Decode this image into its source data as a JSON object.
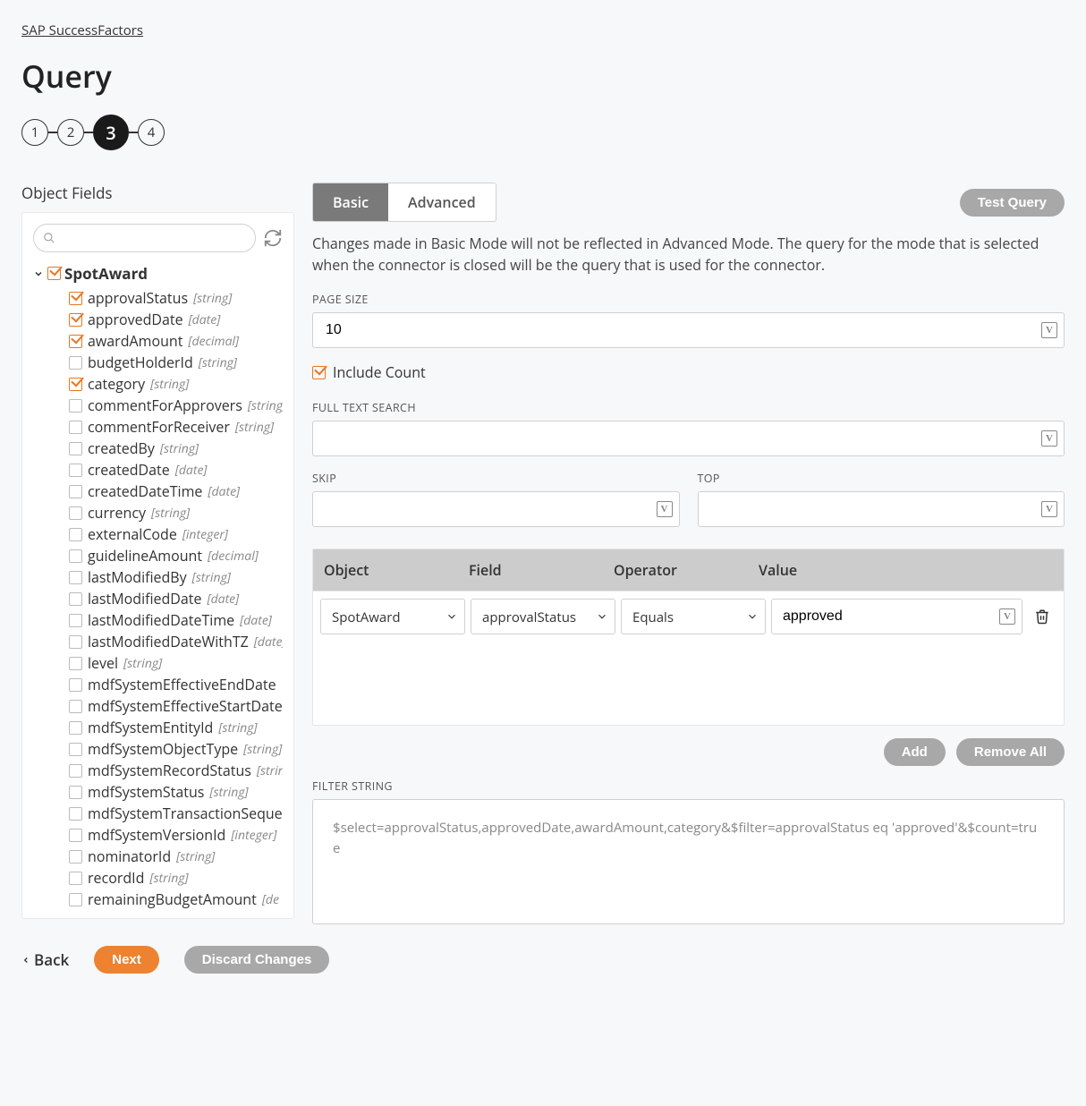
{
  "breadcrumb": "SAP SuccessFactors",
  "page_title": "Query",
  "stepper": {
    "steps": [
      "1",
      "2",
      "3",
      "4"
    ],
    "active_index": 2
  },
  "left": {
    "title": "Object Fields",
    "search_placeholder": "",
    "root_name": "SpotAward",
    "fields": [
      {
        "name": "approvalStatus",
        "type": "[string]",
        "checked": true
      },
      {
        "name": "approvedDate",
        "type": "[date]",
        "checked": true
      },
      {
        "name": "awardAmount",
        "type": "[decimal]",
        "checked": true
      },
      {
        "name": "budgetHolderId",
        "type": "[string]",
        "checked": false
      },
      {
        "name": "category",
        "type": "[string]",
        "checked": true
      },
      {
        "name": "commentForApprovers",
        "type": "[string]",
        "checked": false
      },
      {
        "name": "commentForReceiver",
        "type": "[string]",
        "checked": false
      },
      {
        "name": "createdBy",
        "type": "[string]",
        "checked": false
      },
      {
        "name": "createdDate",
        "type": "[date]",
        "checked": false
      },
      {
        "name": "createdDateTime",
        "type": "[date]",
        "checked": false
      },
      {
        "name": "currency",
        "type": "[string]",
        "checked": false
      },
      {
        "name": "externalCode",
        "type": "[integer]",
        "checked": false
      },
      {
        "name": "guidelineAmount",
        "type": "[decimal]",
        "checked": false
      },
      {
        "name": "lastModifiedBy",
        "type": "[string]",
        "checked": false
      },
      {
        "name": "lastModifiedDate",
        "type": "[date]",
        "checked": false
      },
      {
        "name": "lastModifiedDateTime",
        "type": "[date]",
        "checked": false
      },
      {
        "name": "lastModifiedDateWithTZ",
        "type": "[date]",
        "checked": false
      },
      {
        "name": "level",
        "type": "[string]",
        "checked": false
      },
      {
        "name": "mdfSystemEffectiveEndDate",
        "type": "",
        "checked": false
      },
      {
        "name": "mdfSystemEffectiveStartDate",
        "type": "",
        "checked": false
      },
      {
        "name": "mdfSystemEntityId",
        "type": "[string]",
        "checked": false
      },
      {
        "name": "mdfSystemObjectType",
        "type": "[string]",
        "checked": false
      },
      {
        "name": "mdfSystemRecordStatus",
        "type": "[string]",
        "checked": false
      },
      {
        "name": "mdfSystemStatus",
        "type": "[string]",
        "checked": false
      },
      {
        "name": "mdfSystemTransactionSequence",
        "type": "",
        "checked": false
      },
      {
        "name": "mdfSystemVersionId",
        "type": "[integer]",
        "checked": false
      },
      {
        "name": "nominatorId",
        "type": "[string]",
        "checked": false
      },
      {
        "name": "recordId",
        "type": "[string]",
        "checked": false
      },
      {
        "name": "remainingBudgetAmount",
        "type": "[de",
        "checked": false
      }
    ]
  },
  "right": {
    "tabs": {
      "basic": "Basic",
      "advanced": "Advanced",
      "active": "basic"
    },
    "test_query": "Test Query",
    "note": "Changes made in Basic Mode will not be reflected in Advanced Mode. The query for the mode that is selected when the connector is closed will be the query that is used for the connector.",
    "page_size_label": "PAGE SIZE",
    "page_size_value": "10",
    "include_count_label": "Include Count",
    "include_count_checked": true,
    "full_text_label": "FULL TEXT SEARCH",
    "full_text_value": "",
    "skip_label": "SKIP",
    "skip_value": "",
    "top_label": "TOP",
    "top_value": "",
    "filter_headers": {
      "object": "Object",
      "field": "Field",
      "operator": "Operator",
      "value": "Value"
    },
    "filter_row": {
      "object": "SpotAward",
      "field": "approvalStatus",
      "operator": "Equals",
      "value": "approved"
    },
    "add_label": "Add",
    "remove_all_label": "Remove All",
    "filter_string_label": "FILTER STRING",
    "filter_string_value": "$select=approvalStatus,approvedDate,awardAmount,category&$filter=approvalStatus eq 'approved'&$count=true"
  },
  "footer": {
    "back": "Back",
    "next": "Next",
    "discard": "Discard Changes"
  }
}
